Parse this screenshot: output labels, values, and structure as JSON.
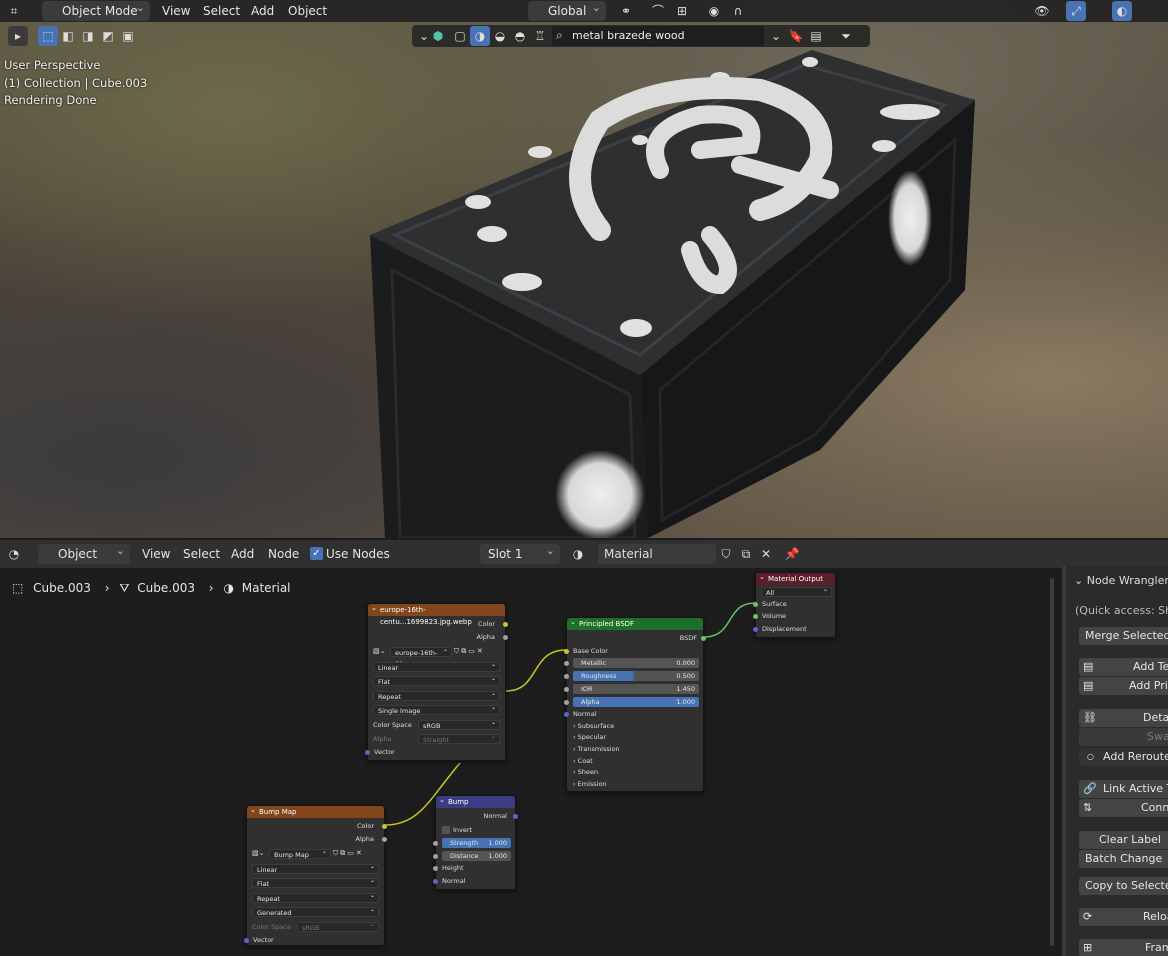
{
  "viewport": {
    "mode": "Object Mode",
    "menu": [
      "View",
      "Select",
      "Add",
      "Object"
    ],
    "transform_orientation": "Global",
    "search_value": "metal brazede wood",
    "overlay": {
      "perspective": "User Perspective",
      "collection": "(1) Collection | Cube.003",
      "status": "Rendering Done"
    }
  },
  "node_editor": {
    "header": {
      "mode": "Object",
      "menu": [
        "View",
        "Select",
        "Add",
        "Node"
      ],
      "use_nodes_label": "Use Nodes",
      "slot": "Slot 1",
      "material": "Material"
    },
    "breadcrumb": [
      "Cube.003",
      "Cube.003",
      "Material"
    ],
    "nodes": {
      "image_texture": {
        "title": "europe-16th-centu...1699823.jpg.webp",
        "outputs": [
          "Color",
          "Alpha"
        ],
        "image": "europe-16th-ce...",
        "interpolation": "Linear",
        "projection": "Flat",
        "extension": "Repeat",
        "source": "Single Image",
        "color_space_label": "Color Space",
        "color_space": "sRGB",
        "alpha_label": "Alpha",
        "alpha_mode": "Straight",
        "input": "Vector"
      },
      "bump_map_tex": {
        "title": "Bump Map",
        "outputs": [
          "Color",
          "Alpha"
        ],
        "image": "Bump Map",
        "interpolation": "Linear",
        "projection": "Flat",
        "extension": "Repeat",
        "source": "Generated",
        "color_space_label": "Color Space",
        "color_space": "sRGB",
        "input": "Vector"
      },
      "bump": {
        "title": "Bump",
        "output": "Normal",
        "invert": "Invert",
        "strength_label": "Strength",
        "strength": "1.000",
        "distance_label": "Distance",
        "distance": "1.000",
        "inputs": [
          "Height",
          "Normal"
        ]
      },
      "principled": {
        "title": "Principled BSDF",
        "output": "BSDF",
        "base_color": "Base Color",
        "fields": [
          {
            "label": "Metallic",
            "value": "0.000"
          },
          {
            "label": "Roughness",
            "value": "0.500"
          },
          {
            "label": "IOR",
            "value": "1.450"
          },
          {
            "label": "Alpha",
            "value": "1.000"
          }
        ],
        "normal": "Normal",
        "panels": [
          "Subsurface",
          "Specular",
          "Transmission",
          "Coat",
          "Sheen",
          "Emission"
        ]
      },
      "output": {
        "title": "Material Output",
        "target": "All",
        "inputs": [
          "Surface",
          "Volume",
          "Displacement"
        ]
      }
    }
  },
  "side_panel": {
    "title": "Node Wrangler",
    "quick_access": "(Quick access: Sh",
    "buttons": [
      "Merge Selected",
      "Add Te",
      "Add Prin",
      "Detac",
      "Swap",
      "Add Reroutes",
      "Link Active To",
      "Connec",
      "Clear Label",
      "Batch Change",
      "Copy to Selected",
      "Reloa",
      "Fram"
    ]
  },
  "colors": {
    "accent": "#4772b3",
    "image_node_header": "#83451c",
    "shader_node_header": "#1e6f2a",
    "vector_node_header": "#3c3c83",
    "output_node_header": "#5c1e2b"
  }
}
